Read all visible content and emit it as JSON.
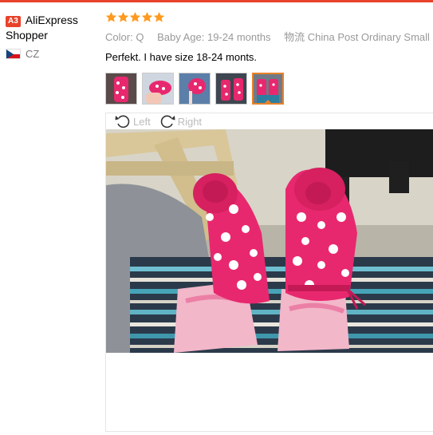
{
  "user": {
    "level_badge": "A3",
    "name": "AliExpress Shopper",
    "country_code": "CZ"
  },
  "review": {
    "rating": 5,
    "meta": [
      {
        "label": "Color:",
        "value": "Q"
      },
      {
        "label": "Baby Age:",
        "value": "19-24 months"
      },
      {
        "label": "物流",
        "value": "China Post Ordinary Small"
      }
    ],
    "text": "Perfekt. I have size 18-24 monts."
  },
  "viewer": {
    "rotate_left_label": "Left",
    "rotate_right_label": "Right",
    "thumbnail_count": 5,
    "active_thumbnail": 5
  },
  "colors": {
    "accent": "#e8422a",
    "star": "#ff9a1f",
    "active_thumb_border": "#e8822a",
    "sock_pink": "#e8286e"
  }
}
